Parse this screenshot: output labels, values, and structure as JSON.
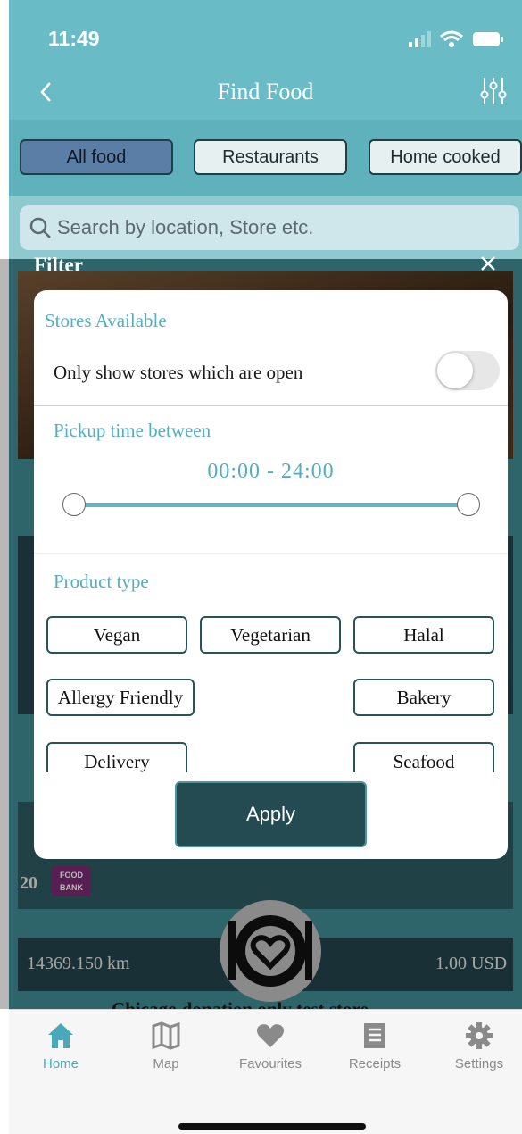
{
  "status": {
    "time": "11:49"
  },
  "header": {
    "title": "Find Food"
  },
  "chips": [
    {
      "label": "All food",
      "active": true
    },
    {
      "label": "Restaurants",
      "active": false
    },
    {
      "label": "Home cooked",
      "active": false
    }
  ],
  "search": {
    "placeholder": "Search by location, Store etc."
  },
  "background": {
    "distance": "14369.150 km",
    "price": "1.00 USD",
    "count": "20",
    "store_name": "Chicago donation only test store",
    "logo_text": "FOOD BANK"
  },
  "overlay": {
    "title": "Filter"
  },
  "filter": {
    "stores_section": "Stores Available",
    "open_only_label": "Only show stores which are open",
    "open_only_enabled": false,
    "pickup_section": "Pickup time between",
    "pickup_range": "00:00 - 24:00",
    "product_section": "Product type",
    "product_types": [
      "Vegan",
      "Vegetarian",
      "Halal",
      "Allergy Friendly",
      "Bakery",
      "Delivery",
      "Seafood"
    ],
    "apply_label": "Apply"
  },
  "tabs": [
    {
      "label": "Home",
      "icon": "home-icon",
      "active": true
    },
    {
      "label": "Map",
      "icon": "map-icon",
      "active": false
    },
    {
      "label": "Favourites",
      "icon": "heart-icon",
      "active": false
    },
    {
      "label": "Receipts",
      "icon": "receipt-icon",
      "active": false
    },
    {
      "label": "Settings",
      "icon": "gear-icon",
      "active": false
    }
  ],
  "colors": {
    "accent": "#69bcc6",
    "dark": "#244a52",
    "section_text": "#52aec1"
  }
}
